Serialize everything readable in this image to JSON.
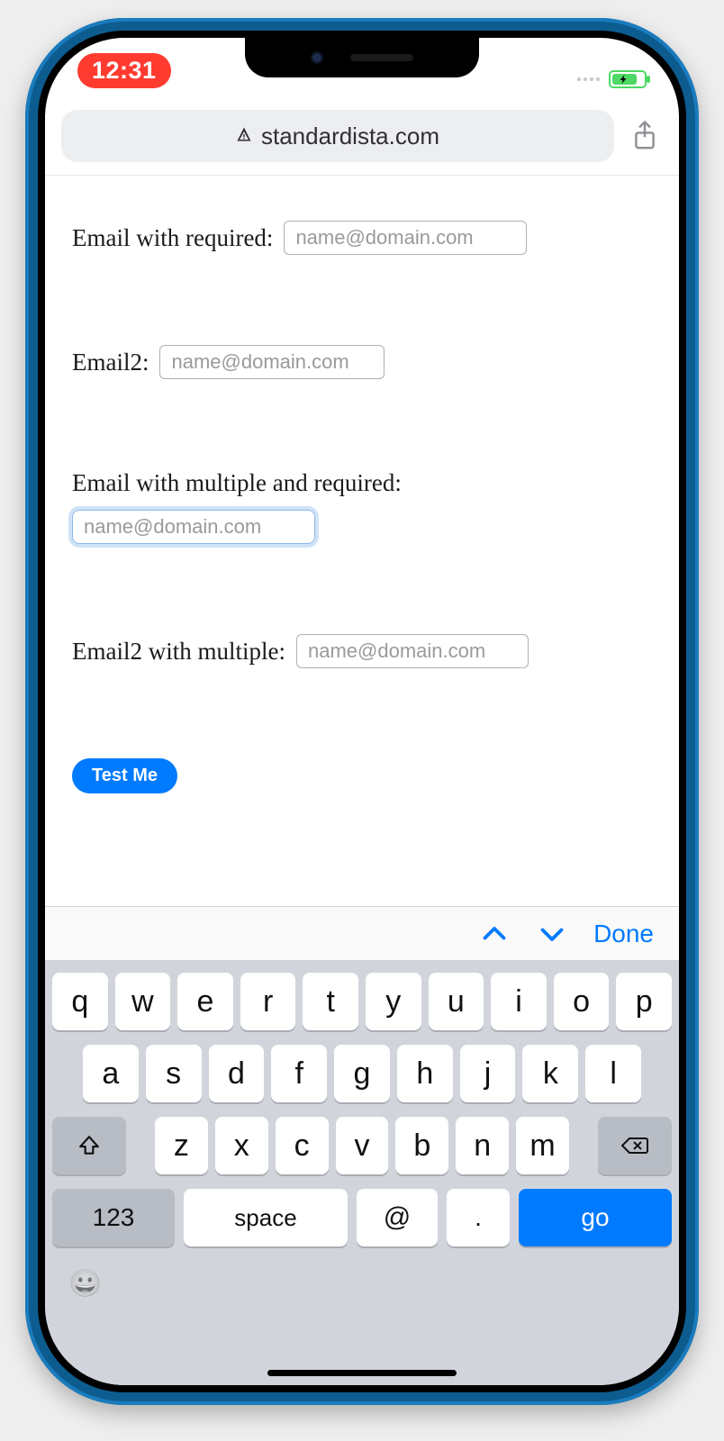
{
  "status": {
    "time": "12:31"
  },
  "browser": {
    "url": "standardista.com"
  },
  "form": {
    "f1": {
      "label": "Email with required:",
      "placeholder": "name@domain.com",
      "value": ""
    },
    "f2": {
      "label": "Email2:",
      "placeholder": "name@domain.com",
      "value": ""
    },
    "f3": {
      "label": "Email with multiple and required:",
      "placeholder": "name@domain.com",
      "value": ""
    },
    "f4": {
      "label": "Email2 with multiple:",
      "placeholder": "name@domain.com",
      "value": ""
    },
    "submit": "Test Me"
  },
  "accessory": {
    "done": "Done"
  },
  "keyboard": {
    "row1": [
      "q",
      "w",
      "e",
      "r",
      "t",
      "y",
      "u",
      "i",
      "o",
      "p"
    ],
    "row2": [
      "a",
      "s",
      "d",
      "f",
      "g",
      "h",
      "j",
      "k",
      "l"
    ],
    "row3": [
      "z",
      "x",
      "c",
      "v",
      "b",
      "n",
      "m"
    ],
    "k123": "123",
    "space": "space",
    "at": "@",
    "dot": ".",
    "go": "go"
  }
}
